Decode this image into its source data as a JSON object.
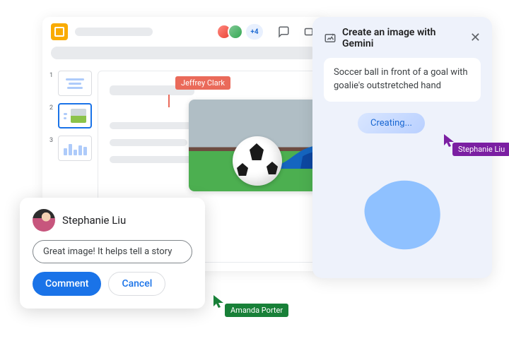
{
  "app": {
    "collaborators": {
      "more_count": "+4"
    },
    "thumbnails": [
      "1",
      "2",
      "3"
    ]
  },
  "cursors": {
    "jeffrey": "Jeffrey Clark",
    "amanda": "Amanda Porter",
    "stephanie": "Stephanie Liu"
  },
  "comment": {
    "author": "Stephanie Liu",
    "draft": "Great image! It helps tell a story",
    "submit_label": "Comment",
    "cancel_label": "Cancel"
  },
  "gemini": {
    "title": "Create an image with Gemini",
    "prompt": "Soccer ball in front of a goal with goalie's outstretched hand",
    "status": "Creating..."
  }
}
